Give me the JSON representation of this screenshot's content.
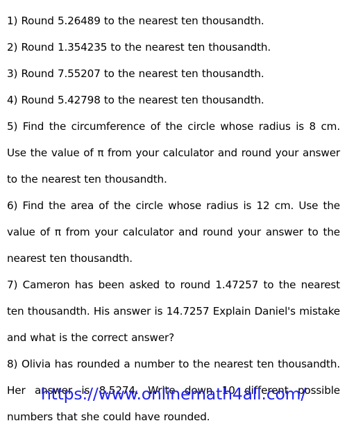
{
  "document": {
    "type": "math-worksheet",
    "topic": "Rounding to the nearest ten thousandth",
    "background_color": "#ffffff",
    "text_color": "#000000",
    "url_color": "#2222ee"
  },
  "questions": [
    {
      "number": "1)",
      "text": "Round 5.26489  to the nearest ten thousandth.",
      "full": "1)  Round 5.26489  to the nearest ten thousandth.",
      "lines": 1
    },
    {
      "number": "2)",
      "text": "Round 1.354235  to the nearest ten thousandth.",
      "full": "2)  Round 1.354235  to the nearest ten thousandth.",
      "lines": 1
    },
    {
      "number": "3)",
      "text": "Round 7.55207  to the nearest ten thousandth.",
      "full": "3)  Round 7.55207  to the nearest ten thousandth.",
      "lines": 1
    },
    {
      "number": "4)",
      "text": "Round 5.42798  to the nearest ten thousandth.",
      "full": "4)  Round 5.42798  to the nearest ten thousandth.",
      "lines": 1
    },
    {
      "number": "5)",
      "text": "Find the circumference of the circle whose radius is 8 cm. Use the value of π from your calculator and round your answer to the nearest ten thousandth.",
      "full": "5)   Find the circumference of the circle whose radius is 8 cm. Use the value of π from your calculator and round your answer to the nearest ten thousandth.",
      "lines": 3
    },
    {
      "number": "6)",
      "text": "Find the area of the circle whose radius is 12 cm. Use the value of π from your calculator and round your answer to the nearest ten thousandth.",
      "full": "6)   Find the area of the circle whose radius is 12 cm. Use the value of π from your calculator and round your answer to the nearest ten thousandth.",
      "lines": 3
    },
    {
      "number": "7)",
      "text": "Cameron has been asked to round 1.47257 to the nearest ten thousandth. His answer is 14.7257 Explain Daniel's mistake and what is the correct answer?",
      "full": "7)  Cameron has been asked to round 1.47257 to the nearest ten thousandth.  His answer is 14.7257 Explain Daniel's mistake and what is the correct answer?",
      "lines": 3
    },
    {
      "number": "8)",
      "text": "Olivia has rounded a number to the nearest ten thousandth. Her answer is 8.5274. Write down 10 different possible numbers that she could have rounded.",
      "full": "8)   Olivia has rounded a number to the nearest ten thousandth. Her answer is 8.5274. Write down 10 different possible numbers that she could have rounded.",
      "lines": 3
    }
  ],
  "footer": {
    "url": "https://www.onlinemath4all.com/"
  }
}
